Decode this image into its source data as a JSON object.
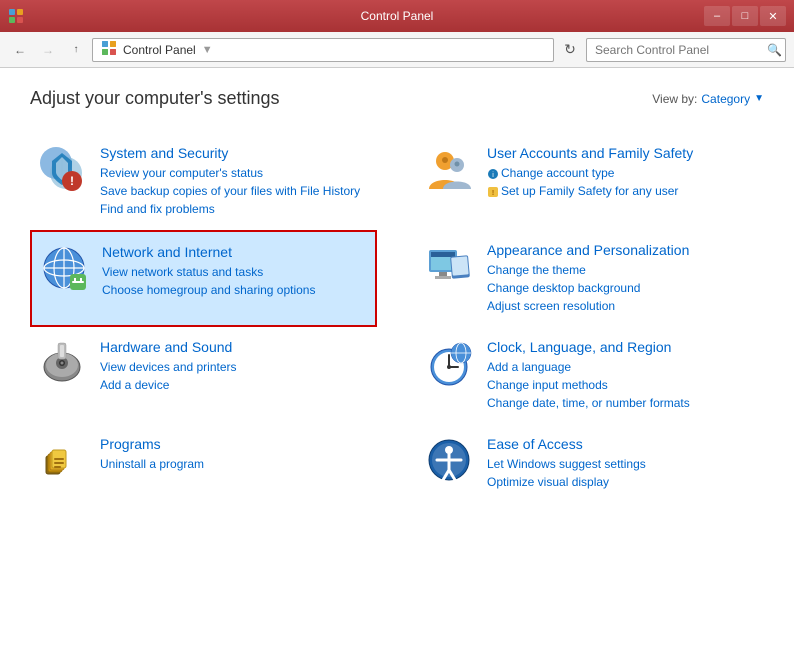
{
  "titleBar": {
    "title": "Control Panel",
    "appIcon": "control-panel-icon",
    "minimizeLabel": "–",
    "maximizeLabel": "□",
    "closeLabel": "✕"
  },
  "addressBar": {
    "backTooltip": "Back",
    "forwardTooltip": "Forward",
    "upTooltip": "Up",
    "pathIcon": "control-panel-path-icon",
    "pathText": "Control Panel",
    "refreshTooltip": "Refresh",
    "dropdownTooltip": "Recent locations",
    "searchPlaceholder": "Search Control Panel"
  },
  "mainContent": {
    "pageTitle": "Adjust your computer's settings",
    "viewBy": "View by:",
    "viewByOption": "Category",
    "categories": [
      {
        "id": "system-security",
        "name": "System and Security",
        "links": [
          "Review your computer's status",
          "Save backup copies of your files with File History",
          "Find and fix problems"
        ],
        "highlighted": false
      },
      {
        "id": "user-accounts",
        "name": "User Accounts and Family Safety",
        "links": [
          "Change account type",
          "Set up Family Safety for any user"
        ],
        "highlighted": false
      },
      {
        "id": "network-internet",
        "name": "Network and Internet",
        "links": [
          "View network status and tasks",
          "Choose homegroup and sharing options"
        ],
        "highlighted": true
      },
      {
        "id": "appearance",
        "name": "Appearance and Personalization",
        "links": [
          "Change the theme",
          "Change desktop background",
          "Adjust screen resolution"
        ],
        "highlighted": false
      },
      {
        "id": "hardware-sound",
        "name": "Hardware and Sound",
        "links": [
          "View devices and printers",
          "Add a device"
        ],
        "highlighted": false
      },
      {
        "id": "clock-language",
        "name": "Clock, Language, and Region",
        "links": [
          "Add a language",
          "Change input methods",
          "Change date, time, or number formats"
        ],
        "highlighted": false
      },
      {
        "id": "programs",
        "name": "Programs",
        "links": [
          "Uninstall a program"
        ],
        "highlighted": false
      },
      {
        "id": "ease-access",
        "name": "Ease of Access",
        "links": [
          "Let Windows suggest settings",
          "Optimize visual display"
        ],
        "highlighted": false
      }
    ]
  }
}
